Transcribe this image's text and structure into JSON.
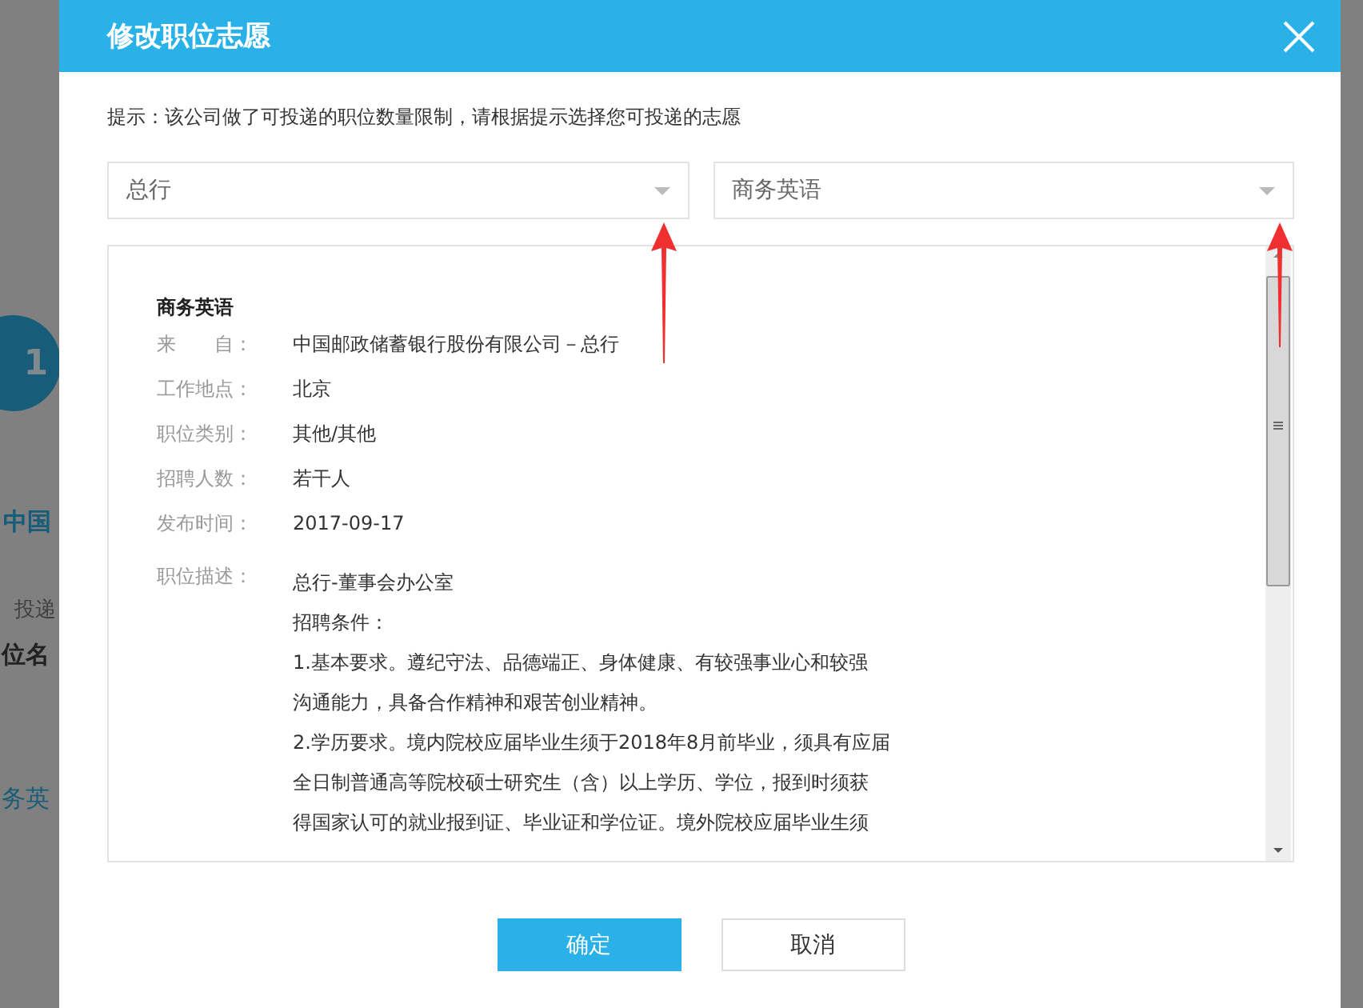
{
  "background": {
    "step": "1",
    "texts": [
      {
        "kind": "company",
        "text": "中国"
      },
      {
        "kind": "note",
        "text": "投递"
      },
      {
        "kind": "heading",
        "text": "位名"
      },
      {
        "kind": "link",
        "text": "务英"
      }
    ]
  },
  "dialog": {
    "title": "修改职位志愿",
    "hint": "提示：该公司做了可投递的职位数量限制，请根据提示选择您可投递的志愿",
    "selects": [
      {
        "value": "总行"
      },
      {
        "value": "商务英语"
      }
    ],
    "detail": {
      "heading": "商务英语",
      "fields": [
        {
          "label": "来　　自：",
          "value": "中国邮政储蓄银行股份有限公司－总行"
        },
        {
          "label": "工作地点：",
          "value": "北京"
        },
        {
          "label": "职位类别：",
          "value": "其他/其他"
        },
        {
          "label": "招聘人数：",
          "value": "若干人"
        },
        {
          "label": "发布时间：",
          "value": "2017-09-17"
        }
      ],
      "description": {
        "label": "职位描述：",
        "lines": [
          "总行-董事会办公室",
          "招聘条件：",
          "1.基本要求。遵纪守法、品德端正、身体健康、有较强事业心和较强",
          "沟通能力，具备合作精神和艰苦创业精神。",
          "2.学历要求。境内院校应届毕业生须于2018年8月前毕业，须具有应届",
          "全日制普通高等院校硕士研究生（含）以上学历、学位，报到时须获",
          "得国家认可的就业报到证、毕业证和学位证。境外院校应届毕业生须"
        ]
      }
    },
    "buttons": [
      {
        "label": "确定",
        "kind": "primary"
      },
      {
        "label": "取消",
        "kind": "secondary"
      }
    ]
  }
}
